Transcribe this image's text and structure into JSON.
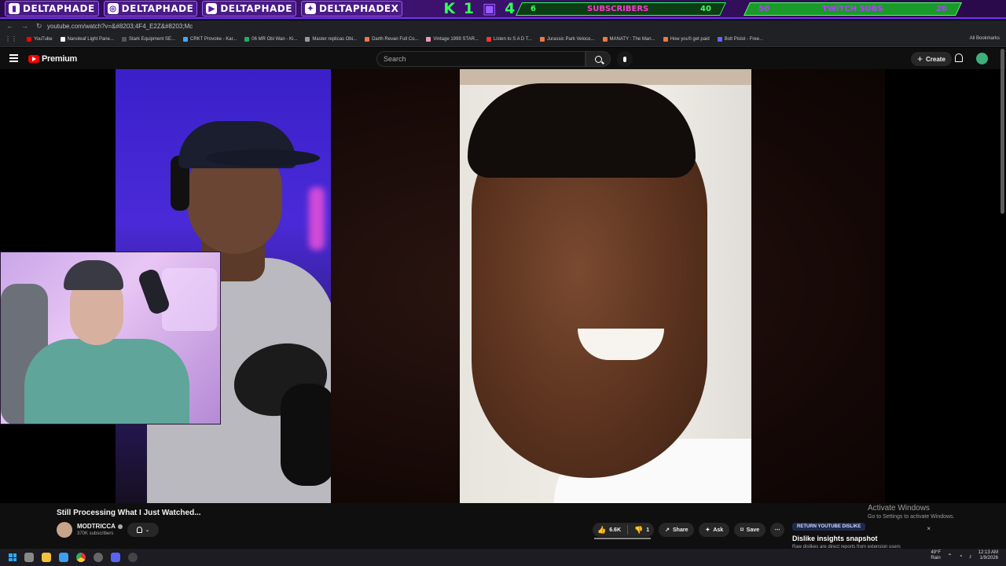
{
  "overlay": {
    "socials": [
      {
        "icon": "twitch-icon",
        "handle": "DELTAPHADE"
      },
      {
        "icon": "instagram-icon",
        "handle": "DELTAPHADE"
      },
      {
        "icon": "youtube-icon",
        "handle": "DELTAPHADE"
      },
      {
        "icon": "twitter-icon",
        "handle": "DELTAPHADEX"
      }
    ],
    "k_counter": "K 1",
    "twitch_count": "4",
    "subs_current": "6",
    "subs_label": "SUBSCRIBERS",
    "subs_goal": "40",
    "twitch_subs_current": "50",
    "twitch_subs_label": "TWITCH SUBS",
    "twitch_subs_goal": "20",
    "colors": {
      "accent": "#7b2cff",
      "green": "#33ff55",
      "pink": "#ff3ad1"
    }
  },
  "browser": {
    "url": "youtube.com/watch?v=&#8203;4F4_E2Z&#8203;Mc",
    "bookmarks": [
      "YouTube",
      "Nanoleaf Light Pane...",
      "Stark Equipment SE...",
      "CRKT Provoke - Kar...",
      "06 MR Obi Wan - Ki...",
      "Master replicas Obi...",
      "Darth Revan Full Co...",
      "Vintage 1999 STAR...",
      "Listen to S A D T...",
      "Jurassic Park Veloce...",
      "MANATY : The Man...",
      "How you'll get paid",
      "Bolt Pistol - Free..."
    ],
    "all_bookmarks": "All Bookmarks"
  },
  "youtube": {
    "brand": "Premium",
    "search_placeholder": "Search",
    "create_label": "Create",
    "video_title": "Still Processing What I Just Watched...",
    "channel_name": "MODTRICCA",
    "channel_subs": "370K subscribers",
    "likes": "6.6K",
    "dislikes": "1",
    "share": "Share",
    "ask": "Ask",
    "save": "Save"
  },
  "dislike_panel": {
    "badge": "RETURN YOUTUBE DISLIKE",
    "title": "Dislike insights snapshot",
    "subtitle": "Raw dislikes are direct reports from extension users",
    "close": "×"
  },
  "watermark": {
    "line1": "Activate Windows",
    "line2": "Go to Settings to activate Windows."
  },
  "taskbar": {
    "weather_temp": "49°F",
    "weather_desc": "Rain",
    "time": "12:13 AM",
    "date": "1/9/2026"
  }
}
